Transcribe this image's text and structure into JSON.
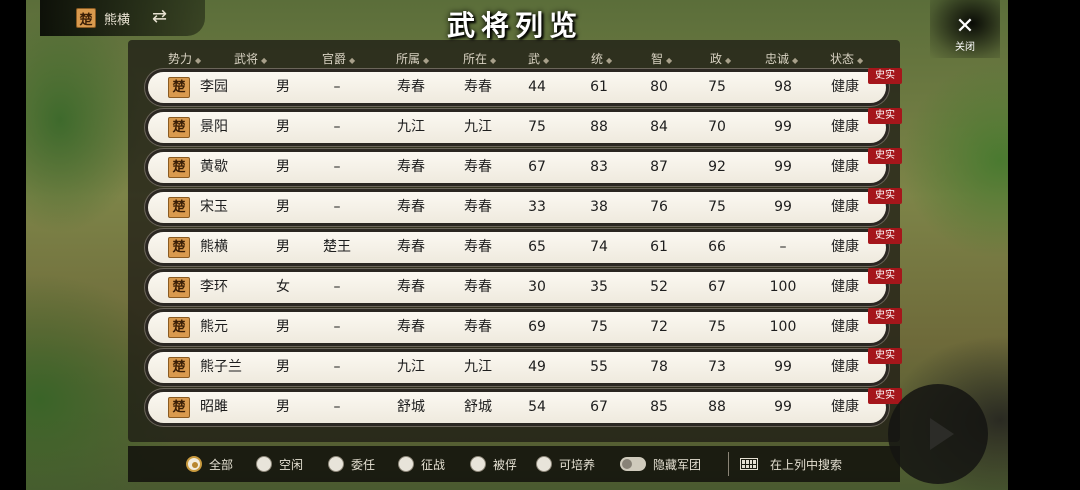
{
  "ruler": {
    "badge": "楚",
    "name": "熊横",
    "swap_icon": "⇄"
  },
  "title": "武将列览",
  "close": {
    "icon": "✕",
    "label": "关闭"
  },
  "columns": [
    {
      "key": "faction",
      "label": "势力"
    },
    {
      "key": "name",
      "label": "武将"
    },
    {
      "key": "title",
      "label": "官爵"
    },
    {
      "key": "belong",
      "label": "所属"
    },
    {
      "key": "location",
      "label": "所在"
    },
    {
      "key": "war",
      "label": "武"
    },
    {
      "key": "lead",
      "label": "统"
    },
    {
      "key": "int",
      "label": "智"
    },
    {
      "key": "pol",
      "label": "政"
    },
    {
      "key": "loyalty",
      "label": "忠诚"
    },
    {
      "key": "status",
      "label": "状态"
    }
  ],
  "sort_glyph": "◆",
  "history_tag": "史实",
  "rows": [
    {
      "faction": "楚",
      "name": "李园",
      "gender": "男",
      "title": "–",
      "belong": "寿春",
      "location": "寿春",
      "war": "44",
      "lead": "61",
      "int": "80",
      "pol": "75",
      "loyalty": "98",
      "status": "健康"
    },
    {
      "faction": "楚",
      "name": "景阳",
      "gender": "男",
      "title": "–",
      "belong": "九江",
      "location": "九江",
      "war": "75",
      "lead": "88",
      "int": "84",
      "pol": "70",
      "loyalty": "99",
      "status": "健康"
    },
    {
      "faction": "楚",
      "name": "黄歇",
      "gender": "男",
      "title": "–",
      "belong": "寿春",
      "location": "寿春",
      "war": "67",
      "lead": "83",
      "int": "87",
      "pol": "92",
      "loyalty": "99",
      "status": "健康"
    },
    {
      "faction": "楚",
      "name": "宋玉",
      "gender": "男",
      "title": "–",
      "belong": "寿春",
      "location": "寿春",
      "war": "33",
      "lead": "38",
      "int": "76",
      "pol": "75",
      "loyalty": "99",
      "status": "健康"
    },
    {
      "faction": "楚",
      "name": "熊横",
      "gender": "男",
      "title": "楚王",
      "belong": "寿春",
      "location": "寿春",
      "war": "65",
      "lead": "74",
      "int": "61",
      "pol": "66",
      "loyalty": "–",
      "status": "健康"
    },
    {
      "faction": "楚",
      "name": "李环",
      "gender": "女",
      "title": "–",
      "belong": "寿春",
      "location": "寿春",
      "war": "30",
      "lead": "35",
      "int": "52",
      "pol": "67",
      "loyalty": "100",
      "status": "健康"
    },
    {
      "faction": "楚",
      "name": "熊元",
      "gender": "男",
      "title": "–",
      "belong": "寿春",
      "location": "寿春",
      "war": "69",
      "lead": "75",
      "int": "72",
      "pol": "75",
      "loyalty": "100",
      "status": "健康"
    },
    {
      "faction": "楚",
      "name": "熊子兰",
      "gender": "男",
      "title": "–",
      "belong": "九江",
      "location": "九江",
      "war": "49",
      "lead": "55",
      "int": "78",
      "pol": "73",
      "loyalty": "99",
      "status": "健康"
    },
    {
      "faction": "楚",
      "name": "昭雎",
      "gender": "男",
      "title": "–",
      "belong": "舒城",
      "location": "舒城",
      "war": "54",
      "lead": "67",
      "int": "85",
      "pol": "88",
      "loyalty": "99",
      "status": "健康"
    }
  ],
  "filters": [
    {
      "label": "全部",
      "selected": true
    },
    {
      "label": "空闲",
      "selected": false
    },
    {
      "label": "委任",
      "selected": false
    },
    {
      "label": "征战",
      "selected": false
    },
    {
      "label": "被俘",
      "selected": false
    },
    {
      "label": "可培养",
      "selected": false
    }
  ],
  "hide_army_label": "隐藏军团",
  "search_label": "在上列中搜索"
}
